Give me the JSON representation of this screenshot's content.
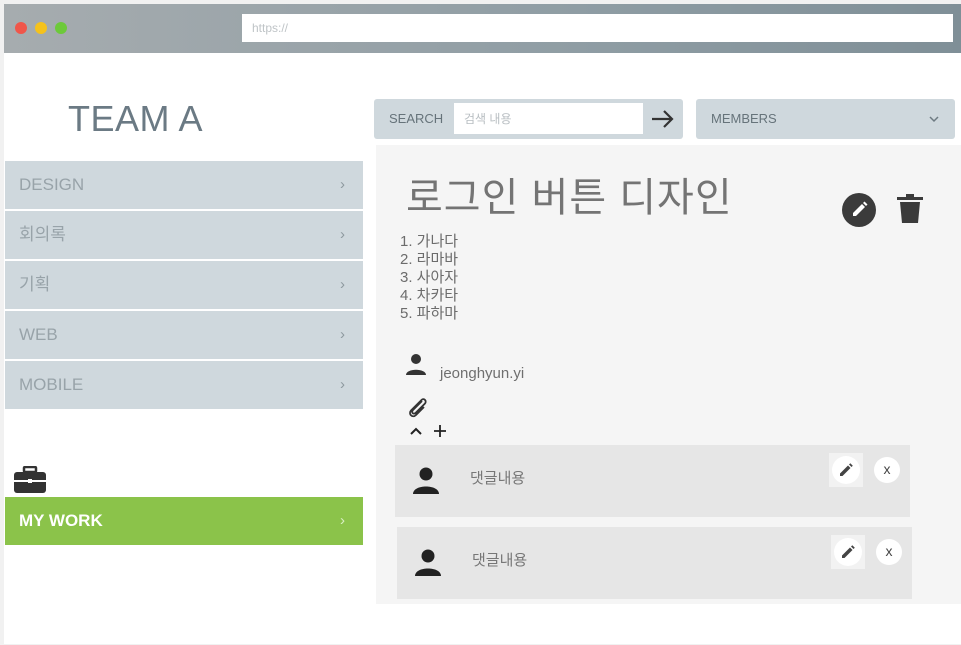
{
  "browser": {
    "url": "https://"
  },
  "sidebar": {
    "team_title": "TEAM A",
    "items": [
      {
        "label": "DESIGN",
        "chevron": "›"
      },
      {
        "label": "회의록",
        "chevron": "›"
      },
      {
        "label": "기획",
        "chevron": "›"
      },
      {
        "label": "WEB",
        "chevron": "›"
      },
      {
        "label": "MOBILE",
        "chevron": "›"
      }
    ],
    "mywork": {
      "label": "MY WORK",
      "chevron": "›"
    },
    "briefcase_icon": "briefcase-icon",
    "accent_color": "#8bc34a"
  },
  "search": {
    "label": "SEARCH",
    "placeholder": "검색 내용",
    "value": "",
    "submit_icon": "arrow-right-icon"
  },
  "members": {
    "label": "MEMBERS",
    "icon": "chevron-down-icon"
  },
  "task": {
    "title": "로그인 버튼 디자인",
    "items": [
      "1. 가나다",
      "2. 라마바",
      "3. 사아자",
      "4. 차카타",
      "5. 파하마"
    ],
    "assignee": "jeonghyun.yi",
    "icons": [
      "edit-icon",
      "trash-icon",
      "person-icon",
      "paperclip-icon",
      "chevron-up-icon",
      "plus-icon"
    ]
  },
  "comments": [
    {
      "text": "댓글내용",
      "close": "x"
    },
    {
      "text": "댓글내용",
      "close": "x"
    }
  ]
}
